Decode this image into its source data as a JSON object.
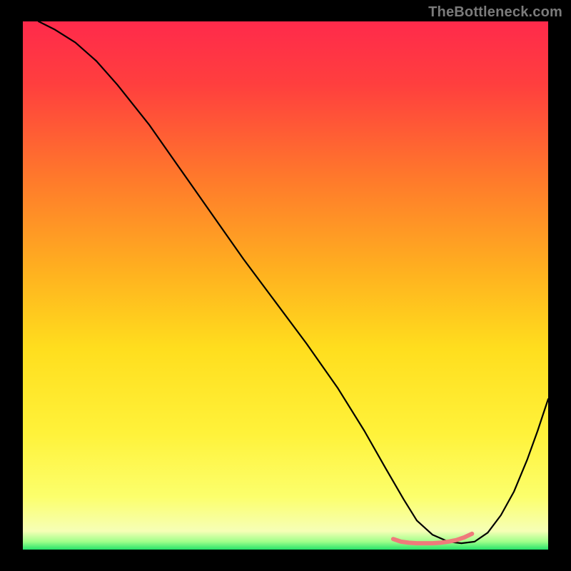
{
  "watermark": "TheBottleneck.com",
  "chart_data": {
    "type": "line",
    "title": "",
    "xlabel": "",
    "ylabel": "",
    "xlim": [
      0,
      100
    ],
    "ylim": [
      0,
      100
    ],
    "grid": false,
    "legend": false,
    "gradient": {
      "stops": [
        {
          "offset": 0.0,
          "color": "#ff2a4b"
        },
        {
          "offset": 0.12,
          "color": "#ff3f3e"
        },
        {
          "offset": 0.3,
          "color": "#ff7a2b"
        },
        {
          "offset": 0.48,
          "color": "#ffb31f"
        },
        {
          "offset": 0.62,
          "color": "#ffde1e"
        },
        {
          "offset": 0.78,
          "color": "#fff23a"
        },
        {
          "offset": 0.9,
          "color": "#fcff6c"
        },
        {
          "offset": 0.965,
          "color": "#f6ffb6"
        },
        {
          "offset": 0.985,
          "color": "#9fff8a"
        },
        {
          "offset": 1.0,
          "color": "#26e36a"
        }
      ]
    },
    "series": [
      {
        "name": "curve",
        "color": "#000000",
        "stroke_width": 2.2,
        "x": [
          3,
          6,
          10,
          14,
          18,
          24,
          30,
          36,
          42,
          48,
          54,
          60,
          65,
          69,
          72.5,
          75,
          78,
          81,
          83.5,
          86,
          88.5,
          91,
          93.5,
          96,
          98,
          100
        ],
        "y": [
          100,
          98.5,
          96,
          92.5,
          88,
          80.5,
          72,
          63.5,
          55,
          47,
          39,
          30.5,
          22.5,
          15.5,
          9.5,
          5.5,
          2.8,
          1.5,
          1.2,
          1.5,
          3.2,
          6.5,
          11,
          17,
          22.5,
          28.5
        ]
      },
      {
        "name": "pink-band",
        "color": "#ef7b7b",
        "stroke_width": 6,
        "x": [
          70.5,
          72,
          73.5,
          75,
          76.5,
          78,
          79.5,
          81,
          82.5,
          84,
          85.5
        ],
        "y": [
          2.0,
          1.5,
          1.3,
          1.2,
          1.2,
          1.2,
          1.3,
          1.5,
          1.8,
          2.3,
          3.0
        ]
      }
    ]
  }
}
